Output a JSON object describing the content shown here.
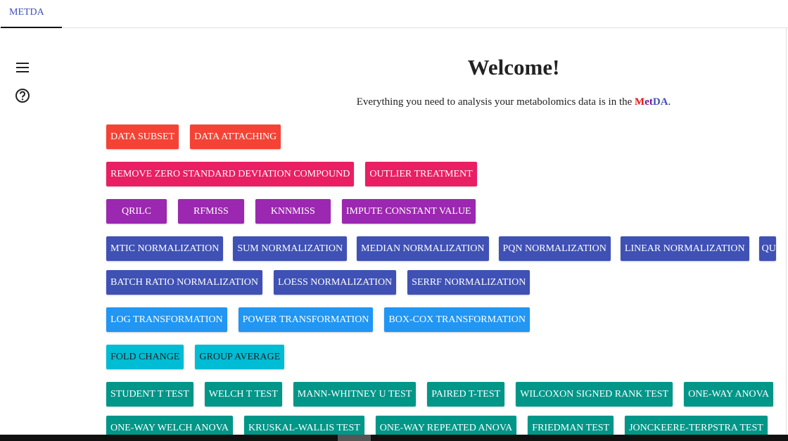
{
  "tab": {
    "label": "METDA"
  },
  "sidebar": {
    "icons": [
      "menu-icon",
      "help-icon"
    ]
  },
  "welcome": {
    "title": "Welcome!",
    "tagline": "Everything you need to analysis your metabolomics data is in the ",
    "brand_m": "M",
    "brand_et": "et",
    "brand_da": "DA",
    "period": "."
  },
  "colors": {
    "red": "#f44336",
    "pink": "#e91e63",
    "purple": "#9c27b0",
    "indigo": "#3f51b5",
    "blue": "#2196f3",
    "cyan": "#00bcd4",
    "teal": "#009688"
  },
  "rows": [
    {
      "color": "#f44336",
      "text": "#fff",
      "buttons": [
        "DATA SUBSET",
        "DATA ATTACHING"
      ]
    },
    {
      "color": "#e91e63",
      "text": "#fff",
      "buttons": [
        "REMOVE ZERO STANDARD DEVIATION COMPOUND",
        "OUTLIER TREATMENT"
      ]
    },
    {
      "color": "#9c27b0",
      "text": "#fff",
      "buttons": [
        "QRILC",
        "RFMISS",
        "KNNMISS",
        "IMPUTE CONSTANT VALUE"
      ]
    },
    {
      "color": "#3f51b5",
      "text": "#fff",
      "buttons": [
        "MTIC NORMALIZATION",
        "SUM NORMALIZATION",
        "MEDIAN NORMALIZATION",
        "PQN NORMALIZATION",
        "LINEAR NORMALIZATION",
        "QU"
      ]
    },
    {
      "color": "#3f51b5",
      "text": "#fff",
      "buttons": [
        "BATCH RATIO NORMALIZATION",
        "LOESS NORMALIZATION",
        "SERRF NORMALIZATION"
      ]
    },
    {
      "color": "#2196f3",
      "text": "#fff",
      "buttons": [
        "LOG TRANSFORMATION",
        "POWER TRANSFORMATION",
        "BOX-COX TRANSFORMATION"
      ]
    },
    {
      "color": "#00bcd4",
      "text": "#222",
      "buttons": [
        "FOLD CHANGE",
        "GROUP AVERAGE"
      ]
    },
    {
      "color": "#009688",
      "text": "#fff",
      "buttons": [
        "STUDENT T TEST",
        "WELCH T TEST",
        "MANN-WHITNEY U TEST",
        "PAIRED T-TEST",
        "WILCOXON SIGNED RANK TEST",
        "ONE-WAY ANOVA"
      ]
    },
    {
      "color": "#009688",
      "text": "#fff",
      "buttons": [
        "ONE-WAY WELCH ANOVA",
        "KRUSKAL-WALLIS TEST",
        "ONE-WAY REPEATED ANOVA",
        "FRIEDMAN TEST",
        "JONCKEERE-TERPSTRA TEST"
      ]
    }
  ]
}
